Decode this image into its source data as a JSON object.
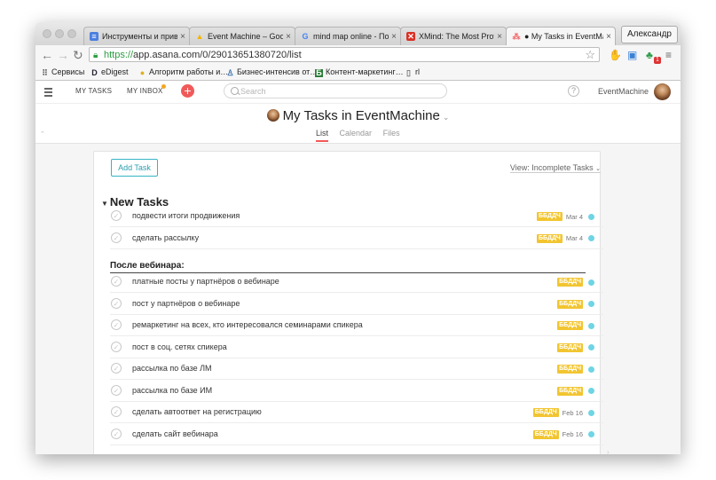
{
  "browser": {
    "tabs": [
      {
        "title": "Инструменты и приви…",
        "icon": "google-docs-icon",
        "color": "#4a7fe0",
        "active": false
      },
      {
        "title": "Event Machine – Googl…",
        "icon": "google-drive-icon",
        "color": "#f4b400",
        "active": false
      },
      {
        "title": "mind map online - Пои…",
        "icon": "google-icon",
        "color": "#4285f4",
        "active": false
      },
      {
        "title": "XMind: The Most Profe…",
        "icon": "xmind-icon",
        "color": "#d93025",
        "active": false
      },
      {
        "title": "● My Tasks in EventMach…",
        "icon": "asana-icon",
        "color": "#f06a6a",
        "active": true
      }
    ],
    "profile_name": "Александр",
    "url_scheme": "https://",
    "url_rest": "app.asana.com/0/29013651380720/list",
    "extension_badge": "1",
    "bookmarks": [
      {
        "label": "Сервисы",
        "icon": "apps-grid-icon"
      },
      {
        "label": "eDigest",
        "icon": "edigest-icon"
      },
      {
        "label": "Алгоритм работы и…",
        "icon": "bulb-icon"
      },
      {
        "label": "Бизнес-интенсив от…",
        "icon": "person-icon"
      },
      {
        "label": "Контент-маркетинг…",
        "icon": "b-icon"
      },
      {
        "label": "rl",
        "icon": "page-icon"
      }
    ]
  },
  "app": {
    "nav": {
      "my_tasks": "MY TASKS",
      "my_inbox": "MY INBOX",
      "search_placeholder": "Search",
      "help": "?",
      "workspace": "EventMachine"
    },
    "project": {
      "title": "My Tasks in EventMachine",
      "tabs": [
        "List",
        "Calendar",
        "Files"
      ],
      "active_tab": "List"
    },
    "list": {
      "add_task": "Add Task",
      "view_selector": "View: Incomplete Tasks",
      "section_title": "New Tasks",
      "subheader": "После вебинара:",
      "tasks_top": [
        {
          "name": "подвести итоги продвижения",
          "tag": "ББДДЧ",
          "due": "Mar 4"
        },
        {
          "name": "сделать рассылку",
          "tag": "ББДДЧ",
          "due": "Mar 4"
        }
      ],
      "tasks_after": [
        {
          "name": "платные посты у партнёров о вебинаре",
          "tag": "ББДДЧ",
          "due": ""
        },
        {
          "name": "пост у партнёров о вебинаре",
          "tag": "ББДДЧ",
          "due": ""
        },
        {
          "name": "ремаркетинг на всех, кто интересовался семинарами спикера",
          "tag": "ББДДЧ",
          "due": ""
        },
        {
          "name": "пост в соц. сетях спикера",
          "tag": "ББДДЧ",
          "due": ""
        },
        {
          "name": "рассылка по базе ЛМ",
          "tag": "ББДДЧ",
          "due": ""
        },
        {
          "name": "рассылка по базе ИМ",
          "tag": "ББДДЧ",
          "due": ""
        },
        {
          "name": "сделать автоответ на регистрацию",
          "tag": "ББДДЧ",
          "due": "Feb 16"
        },
        {
          "name": "сделать сайт вебинара",
          "tag": "ББДДЧ",
          "due": "Feb 16"
        }
      ]
    },
    "colors": {
      "accent_red": "#f15a5a",
      "tag_yellow": "#f2c530",
      "dot_cyan": "#6fd4e4",
      "link_teal": "#2a9fb0"
    }
  }
}
